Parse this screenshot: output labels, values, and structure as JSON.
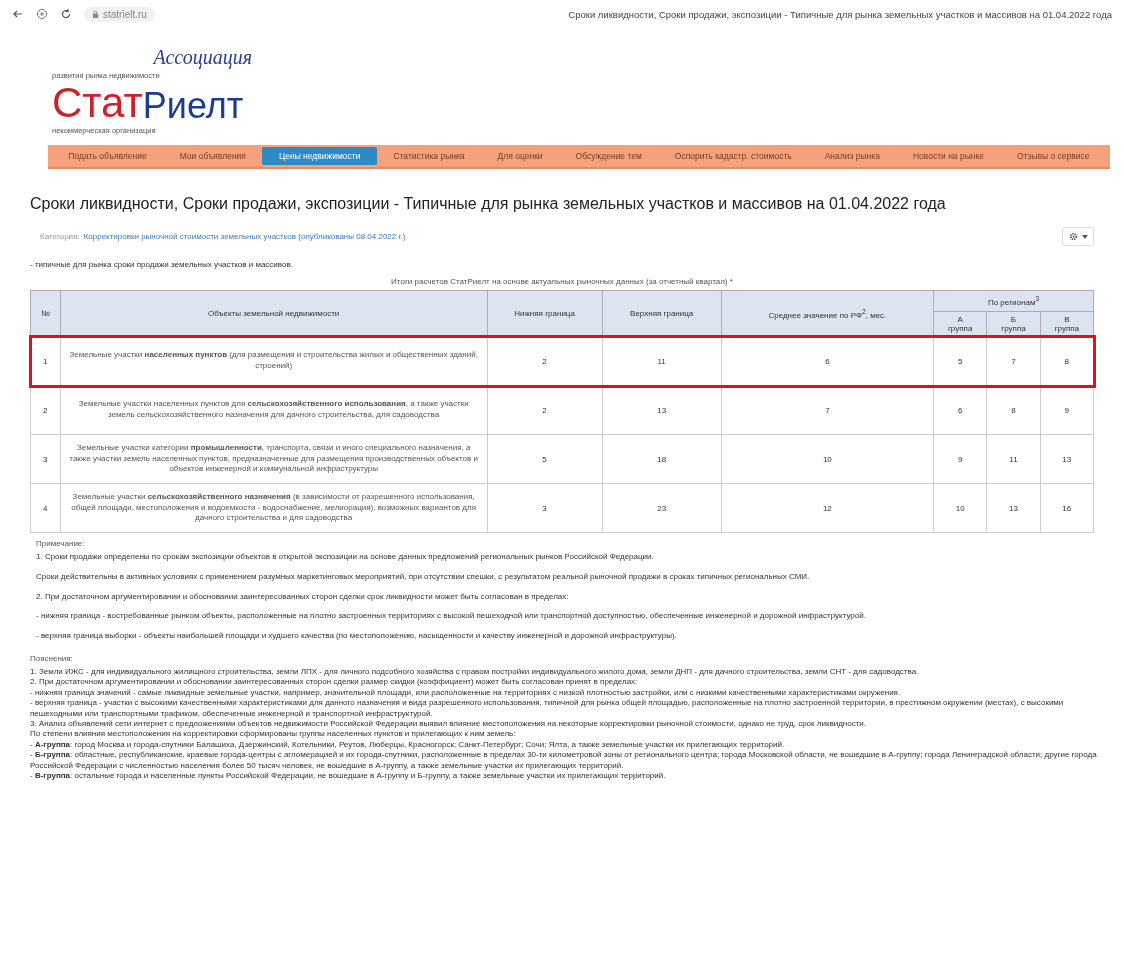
{
  "browser": {
    "url": "statrielt.ru",
    "tab_title": "Сроки ликвидности, Сроки продажи, экспозиции - Типичные для рынка земельных участков и массивов на 01.04.2022 года"
  },
  "logo": {
    "top": "Ассоциация",
    "tagline": "развития рынка недвижимости",
    "part1": "Стат",
    "part2": "Риелт",
    "subline": "некоммерческая организация"
  },
  "nav": [
    {
      "label": "Подать объявление",
      "selected": false
    },
    {
      "label": "Мои объявления",
      "selected": false
    },
    {
      "label": "Цены недвижимости",
      "selected": true
    },
    {
      "label": "Статистика рынка",
      "selected": false
    },
    {
      "label": "Для оценки",
      "selected": false
    },
    {
      "label": "Обсуждение тем",
      "selected": false
    },
    {
      "label": "Оспорить кадастр. стоимость",
      "selected": false
    },
    {
      "label": "Анализ рынка",
      "selected": false
    },
    {
      "label": "Новости на рынке",
      "selected": false
    },
    {
      "label": "Отзывы о сервисе",
      "selected": false
    }
  ],
  "title": "Сроки ликвидности, Сроки продажи, экспозиции - Типичные для рынка земельных участков и массивов на 01.04.2022 года",
  "category_label": "Категория:",
  "category_link": "Корректировки рыночной стоимости земельных участков (опубликованы 08.04.2022 г.)",
  "intro": "- типичные для рынка сроки продажи земельных участков и массивов.",
  "caption": "Итоги расчетов СтатРиелт на основе актуальных рыночных данных (за отчетный квартал) *",
  "table": {
    "columns": [
      "№",
      "Объекты земельной недвижимости",
      "Нижняя граница",
      "Верхняя граница",
      "Среднее значение по РФ$^{2}$, мес."
    ],
    "group_header": "По регионам$^{3}$",
    "groups": [
      {
        "letter": "А",
        "word": "группа"
      },
      {
        "letter": "Б",
        "word": "группа"
      },
      {
        "letter": "В",
        "word": "группа"
      }
    ],
    "rows": [
      {
        "num": "1",
        "object": "Земельные участки **населенных пунктов** (для размещения и строительства жилых и общественных зданий, строений)",
        "low": "2",
        "high": "11",
        "avg": "6",
        "a": "5",
        "b": "7",
        "c": "8",
        "highlighted": true
      },
      {
        "num": "2",
        "object": "Земельные участки населенных пунктов для **сельскохозяйственного использования**, а также участки земель сельскохозяйственного назначения для дачного строительства, для садоводства",
        "low": "2",
        "high": "13",
        "avg": "7",
        "a": "6",
        "b": "8",
        "c": "9",
        "highlighted": false
      },
      {
        "num": "3",
        "object": "Земельные участки категории **промышленности**, транспорта, связи и иного специального назначения, а также участки земель населенных пунктов, предназначенные для размещения производственных объектов и объектов инженерной и коммунальной инфраструктуры",
        "low": "5",
        "high": "18",
        "avg": "10",
        "a": "9",
        "b": "11",
        "c": "13",
        "highlighted": false
      },
      {
        "num": "4",
        "object": "Земельные участки **сельскохозяйственного назначения** (в зависимости от разрешенного использования, общей площади, местоположения и водоемкости - водоснабжение, мелиорация), возможных вариантов для дачного строительства и для садоводства",
        "low": "3",
        "high": "23",
        "avg": "12",
        "a": "10",
        "b": "13",
        "c": "16",
        "highlighted": false
      }
    ]
  },
  "notes_title": "Примечание:",
  "notes": [
    "1. Сроки продажи определены по срокам экспозиции объектов в открытой экспозиции на основе данных предложений региональных рынков Российской Федерации.",
    "Сроки действительны в активных условиях с применением разумных маркетинговых мероприятий, при отсутствии спешки, с результатом реальной рыночной продажи в сроках типичных региональных СМИ.",
    "2. При достаточном аргументировании и обосновании заинтересованных сторон сделки срок ликвидности может быть согласован в пределах:",
    "- нижняя граница - востребованные рынком объекты, расположенные на плотно застроенных территориях с высокой пешеходной или транспортной доступностью, обеспеченные инженерной и дорожной инфраструктурой.",
    "- верхняя граница выборки - объекты наибольшей площади и худшего качества (по местоположению, насыщенности и качеству инженерной и дорожной инфраструктуры)."
  ],
  "expl_title": "Пояснения:",
  "expl": [
    "1. Земли ИЖС - для индивидуального жилищного строительства, земли ЛПХ - для личного подсобного хозяйства с правом постройки индивидуального жилого дома, земли ДНП - для дачного строительства, земли СНТ - для садоводства.",
    "2. При достаточном аргументировании и обосновании заинтересованных сторон сделки размер скидки (коэффициент) может быть согласован принят в пределах:",
    "- нижняя граница значений - самые ликвидные земельные участки, например, значительной площади, или расположенные на территориях с низкой плотностью застройки, или с низкими качественными характеристиками окружения.",
    "- верхняя граница - участки с высокими качественными характеристиками для данного назначения и вида разрешенного использования, типичной для рынка общей площадью, расположенные на плотно застроенной территории, в престижном окружении (местах), с высокими пешеходными или транспортными трафиком, обеспеченные инженерной и транспортной инфраструктурой.",
    "3. Анализ объявлений сети интернет с предложениями объектов недвижимости Российской Федерации выявил влияние местоположения на некоторые корректировки рыночной стоимости, однако не труд, срок ликвидности.",
    "По степени влияния местоположения на корректировки сформированы группы населенных пунктов и прилегающих к ним земель:",
    "- **А-группа**: город Москва и города-спутники Балашиха, Дзержинский, Котельники, Реутов, Люберцы, Красногорск; Санкт-Петербург; Сочи; Ялта, а также земельные участки их прилегающих территорий.",
    "- **Б-группа**: областные, республиканские, краевые города-центры с агломерацией и их города-спутники, расположенные в пределах 30-ти километровой зоны от регионального центра; города Московской области, не вошедшие в А-группу; города Ленинградской области; другие города Российской Федерации с численностью населения более 50 тысяч человек, не вошедшие в А-группу, а также земельные участки их прилегающих территорий.",
    "- **В-группа**: остальные города и населенные пункты Российской Федерации, не вошедшие в А-группу и Б-группу, а также земельные участки их прилегающих территорий."
  ]
}
